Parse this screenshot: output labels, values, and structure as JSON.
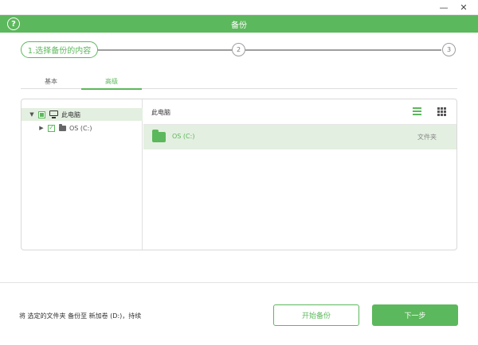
{
  "window": {
    "minimize": "—",
    "close": "✕"
  },
  "header": {
    "title": "备份",
    "help": "?"
  },
  "stepper": {
    "step1": "1.选择备份的内容",
    "step2": "2",
    "step3": "3"
  },
  "tabs": [
    {
      "label": "基本"
    },
    {
      "label": "高级"
    }
  ],
  "tree": {
    "root": {
      "label": "此电脑",
      "state": "partial"
    },
    "child": {
      "label": "OS (C:)",
      "state": "checked"
    }
  },
  "content": {
    "path": "此电脑",
    "rows": [
      {
        "name": "OS (C:)",
        "type": "文件夹"
      }
    ]
  },
  "footer": {
    "summary": "将 选定的文件夹 备份至 新加卷 (D:)，持续",
    "start_button": "开始备份",
    "next_button": "下一步"
  },
  "colors": {
    "accent": "#5cb85c",
    "selection": "#e3efe0"
  },
  "icons": [
    "help-icon",
    "minimize-icon",
    "close-icon",
    "computer-icon",
    "drive-folder-icon",
    "folder-icon",
    "list-view-icon",
    "grid-view-icon",
    "caret-down-icon",
    "caret-right-icon"
  ]
}
